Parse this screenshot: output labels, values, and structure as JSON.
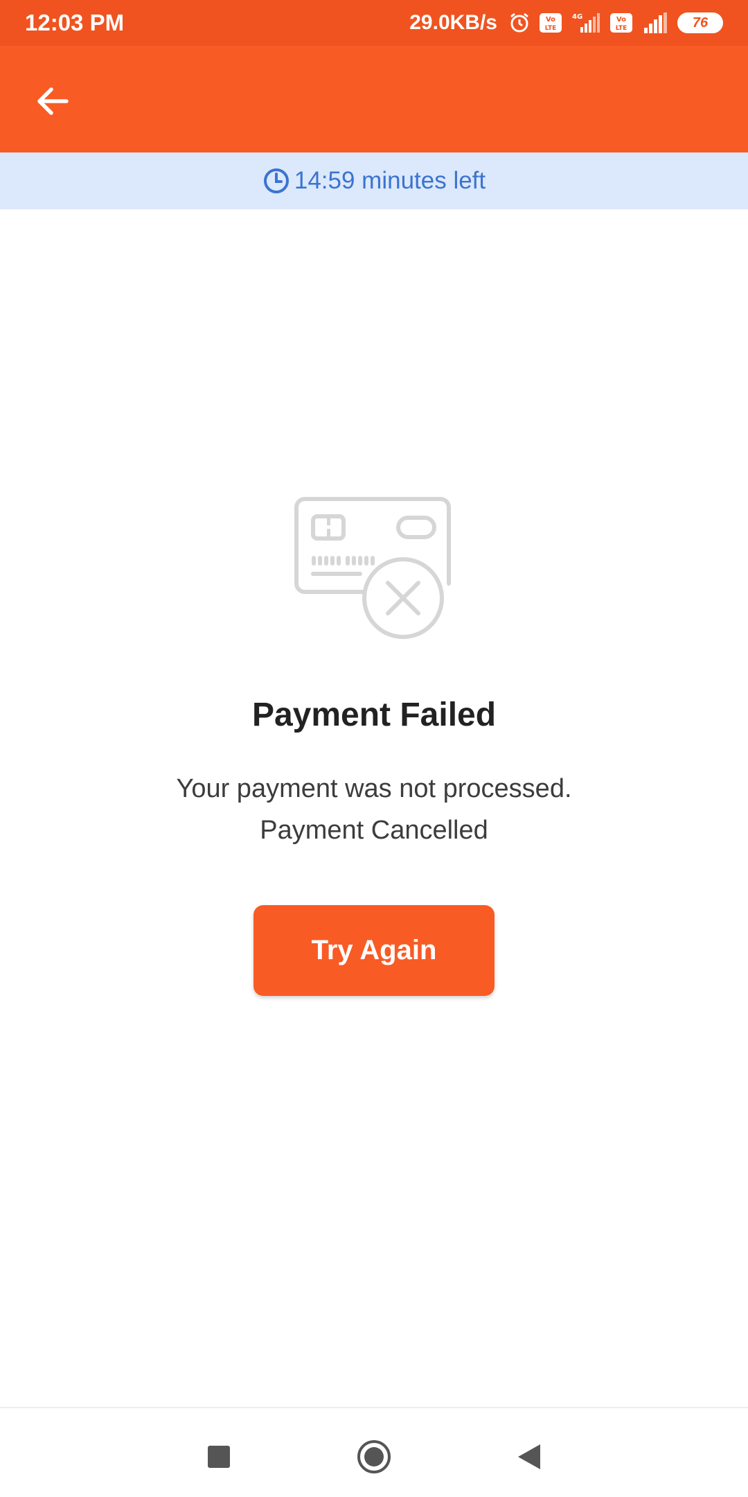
{
  "status_bar": {
    "time": "12:03 PM",
    "network_speed": "29.0KB/s",
    "network_type": "4G",
    "battery": "76",
    "icons": [
      "alarm-icon",
      "volte-icon",
      "signal-icon",
      "volte-icon",
      "signal-icon",
      "battery-icon"
    ]
  },
  "app_bar": {
    "back_icon": "arrow-left-icon"
  },
  "timer": {
    "icon": "clock-icon",
    "text": "14:59 minutes left"
  },
  "result": {
    "illustration": "card-failed-icon",
    "title": "Payment Failed",
    "message_line1": "Your payment was not processed.",
    "message_line2": "Payment Cancelled"
  },
  "actions": {
    "try_again_label": "Try Again"
  },
  "navigation": {
    "recents_icon": "square-icon",
    "home_icon": "circle-icon",
    "back_icon": "triangle-back-icon"
  },
  "colors": {
    "status_bar": "#f0531f",
    "app_bar": "#f95b25",
    "timer_banner": "#dce8fb",
    "timer_text": "#3a74d1",
    "button": "#f95b25",
    "illustration": "#d6d6d6"
  }
}
